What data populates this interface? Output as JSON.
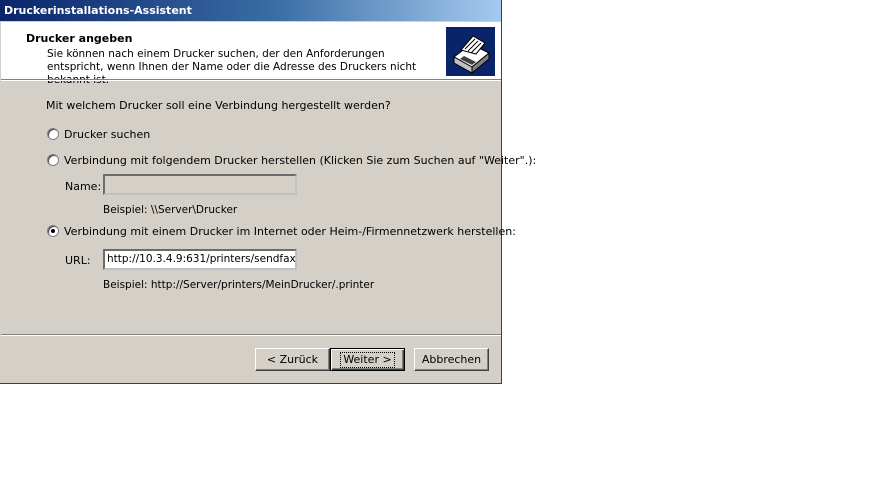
{
  "window": {
    "title": "Druckerinstallations-Assistent"
  },
  "header": {
    "title": "Drucker angeben",
    "description": "Sie können nach einem Drucker suchen, der den Anforderungen entspricht, wenn Ihnen der Name oder die Adresse des Druckers nicht bekannt ist.",
    "icon": "printer-icon"
  },
  "main": {
    "question": "Mit welchem Drucker soll eine Verbindung hergestellt werden?",
    "options": [
      {
        "label": "Drucker suchen",
        "checked": false
      },
      {
        "label": "Verbindung mit folgendem Drucker herstellen (Klicken Sie zum Suchen auf \"Weiter\".):",
        "checked": false
      },
      {
        "label": "Verbindung mit einem Drucker im Internet oder Heim-/Firmennetzwerk herstellen:",
        "checked": true
      }
    ],
    "name_field": {
      "label": "Name:",
      "value": "",
      "example": "Beispiel: \\\\Server\\Drucker"
    },
    "url_field": {
      "label": "URL:",
      "value": "http://10.3.4.9:631/printers/sendfax",
      "example": "Beispiel: http://Server/printers/MeinDrucker/.printer"
    }
  },
  "buttons": {
    "back": "< Zurück",
    "next": "Weiter >",
    "cancel": "Abbrechen"
  }
}
